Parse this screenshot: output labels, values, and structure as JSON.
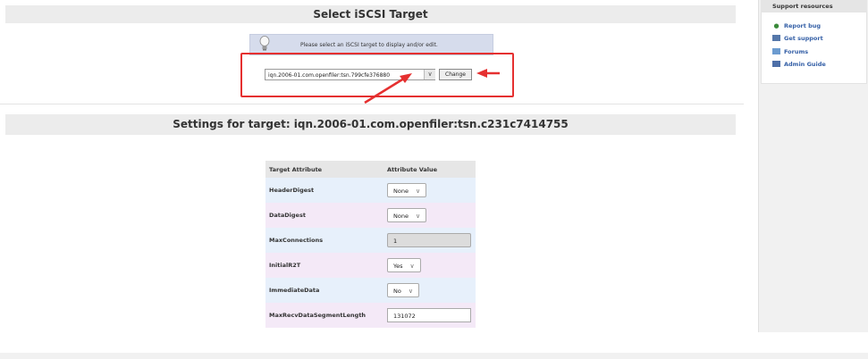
{
  "main": {
    "select_title": "Select iSCSI Target",
    "info_text": "Please select an iSCSI target to display and/or edit.",
    "target_select_value": "iqn.2006-01.com.openfiler:tsn.799cfe376880",
    "change_button": "Change",
    "settings_title": "Settings for target: iqn.2006-01.com.openfiler:tsn.c231c7414755"
  },
  "table": {
    "headers": [
      "Target Attribute",
      "Attribute Value"
    ],
    "rows": [
      {
        "attribute": "HeaderDigest",
        "value": "None",
        "control": "select"
      },
      {
        "attribute": "DataDigest",
        "value": "None",
        "control": "select"
      },
      {
        "attribute": "MaxConnections",
        "value": "1",
        "control": "disabled-input"
      },
      {
        "attribute": "InitialR2T",
        "value": "Yes",
        "control": "select"
      },
      {
        "attribute": "ImmediateData",
        "value": "No",
        "control": "select"
      },
      {
        "attribute": "MaxRecvDataSegmentLength",
        "value": "131072",
        "control": "input"
      }
    ]
  },
  "sidebar": {
    "title": "Support resources",
    "links": [
      {
        "label": "Report bug",
        "icon": "bug-icon"
      },
      {
        "label": "Get support",
        "icon": "support-icon"
      },
      {
        "label": "Forums",
        "icon": "forums-icon"
      },
      {
        "label": "Admin Guide",
        "icon": "guide-icon"
      }
    ]
  },
  "colors": {
    "annotation_red": "#e53030",
    "link_blue": "#345fa6",
    "info_box": "#d6dcec",
    "row_blue": "#e7f0fb",
    "row_pink": "#f4e9f7"
  }
}
